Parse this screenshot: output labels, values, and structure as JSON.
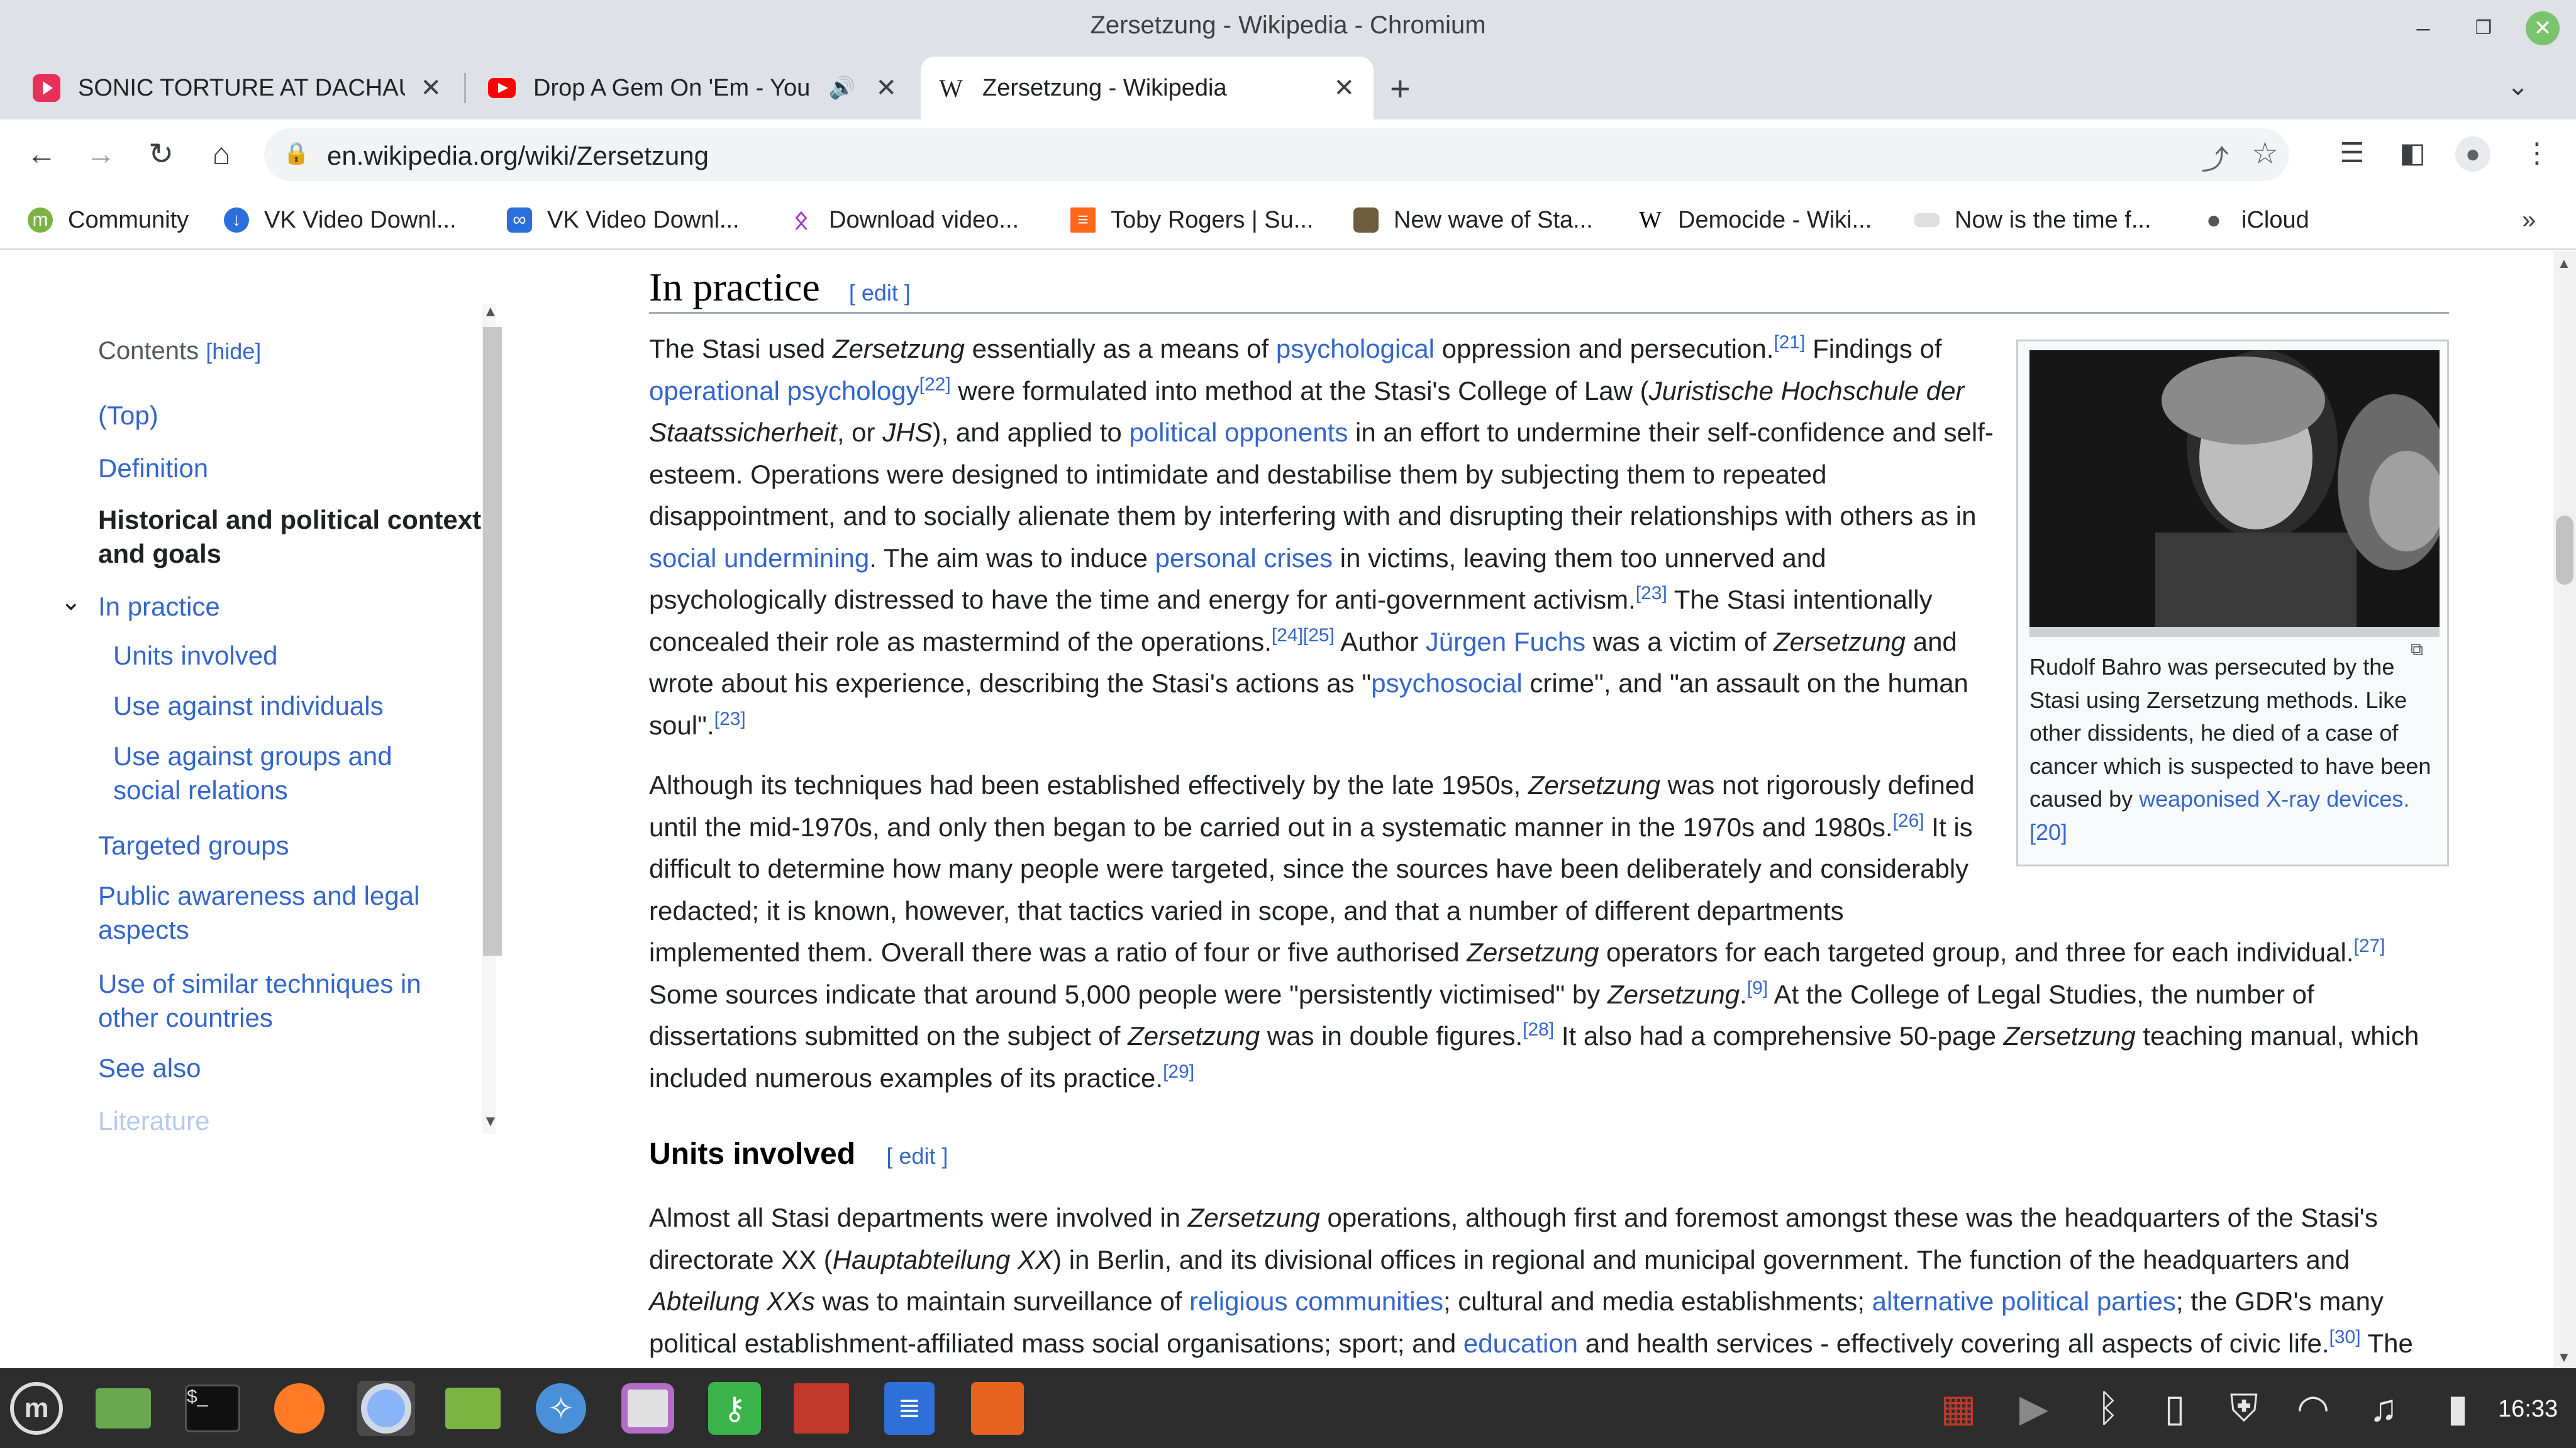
{
  "window": {
    "title": "Zersetzung - Wikipedia - Chromium"
  },
  "tabs": [
    {
      "title": "SONIC TORTURE AT DACHAU",
      "icon": "sonic-icon"
    },
    {
      "title": "Drop A Gem On 'Em - You",
      "icon": "youtube-icon",
      "audio": true
    },
    {
      "title": "Zersetzung - Wikipedia",
      "icon": "wikipedia-icon",
      "active": true
    }
  ],
  "toolbar": {
    "url": "en.wikipedia.org/wiki/Zersetzung"
  },
  "bookmarks": [
    {
      "label": "Community",
      "icon": "community-icon",
      "color": "#7cb342"
    },
    {
      "label": "VK Video Downl...",
      "icon": "vk-icon",
      "color": "#2a6fdb"
    },
    {
      "label": "VK Video Downl...",
      "icon": "vk-alt-icon",
      "color": "#2a6fdb"
    },
    {
      "label": "Download video...",
      "icon": "ok-icon",
      "color": "#a33bd1"
    },
    {
      "label": "Toby Rogers | Su...",
      "icon": "substack-icon",
      "color": "#ff6719"
    },
    {
      "label": "New wave of Sta...",
      "icon": "site-icon",
      "color": "#6d5c3d"
    },
    {
      "label": "Democide - Wiki...",
      "icon": "wikipedia-icon",
      "color": "#000000"
    },
    {
      "label": "Now is the time f...",
      "icon": "blank-icon",
      "color": "#e0e0e0"
    },
    {
      "label": "iCloud",
      "icon": "apple-icon",
      "color": "#555555"
    }
  ],
  "toc": {
    "heading": "Contents",
    "hide_label": "[hide]",
    "items": [
      {
        "label": "(Top)"
      },
      {
        "label": "Definition"
      },
      {
        "label": "Historical and political context",
        "label2": "and goals"
      },
      {
        "label": "In practice"
      },
      {
        "label": "Units involved"
      },
      {
        "label": "Use against individuals"
      },
      {
        "label": "Use against groups and",
        "label2": "social relations"
      },
      {
        "label": "Targeted groups"
      },
      {
        "label": "Public awareness and legal",
        "label2": "aspects"
      },
      {
        "label": "Use of similar techniques in",
        "label2": "other countries"
      },
      {
        "label": "See also"
      },
      {
        "label": "Literature"
      }
    ]
  },
  "article": {
    "section_title": "In practice",
    "edit_label": "[ edit ]",
    "subsection_title": "Units involved",
    "figure_caption_prefix": "Rudolf Bahro was persecuted by the Stasi using Zersetzung methods. Like other dissidents, he died of a case of cancer which is suspected to have been caused by ",
    "figure_caption_link": "weaponised X-ray devices.[20]"
  },
  "taskbar": {
    "clock": "16:33"
  }
}
